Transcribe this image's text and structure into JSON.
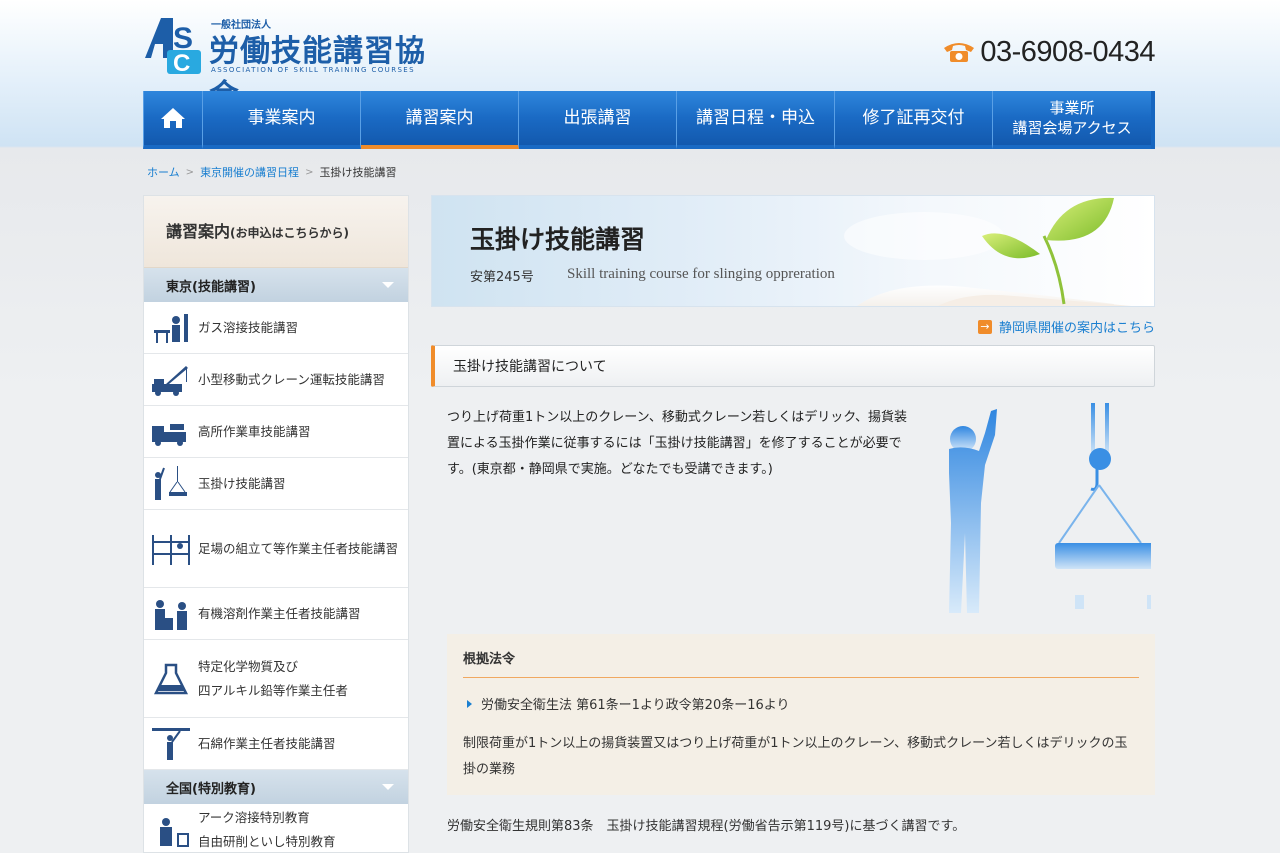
{
  "header": {
    "org_small": "一般社団法人",
    "org_name": "労働技能講習協会",
    "org_en": "ASSOCIATION OF SKILL TRAINING COURSES",
    "phone": "03-6908-0434"
  },
  "nav": {
    "items": [
      {
        "label": "事業案内"
      },
      {
        "label": "講習案内"
      },
      {
        "label": "出張講習"
      },
      {
        "label": "講習日程・申込"
      },
      {
        "label": "修了証再交付"
      }
    ],
    "last_line1": "事業所",
    "last_line2": "講習会場アクセス"
  },
  "breadcrumb": {
    "home": "ホーム",
    "parent": "東京開催の講習日程",
    "current": "玉掛け技能講習",
    "sep": ">"
  },
  "sidebar": {
    "title": "講習案内",
    "title_sub": "(お申込はこちらから)",
    "categories": [
      "東京(技能講習)",
      "全国(特別教育)"
    ],
    "items": [
      {
        "label": "ガス溶接技能講習"
      },
      {
        "label": "小型移動式クレーン運転技能講習"
      },
      {
        "label": "高所作業車技能講習"
      },
      {
        "label": "玉掛け技能講習"
      },
      {
        "label": "足場の組立て等作業主任者技能講習"
      },
      {
        "label": "有機溶剤作業主任者技能講習"
      },
      {
        "label_line1": "特定化学物質及び",
        "label_line2": "四アルキル鉛等作業主任者"
      },
      {
        "label": "石綿作業主任者技能講習"
      }
    ],
    "items2": [
      {
        "label_line1": "アーク溶接特別教育",
        "label_line2": "自由研削といし特別教育"
      }
    ]
  },
  "main": {
    "banner_title": "玉掛け技能講習",
    "banner_no": "安第245号",
    "banner_en": "Skill training course for slinging oppreration",
    "shizuoka_link": "静岡県開催の案内はこちら",
    "section_title": "玉掛け技能講習について",
    "intro": "つり上げ荷重1トン以上のクレーン、移動式クレーン若しくはデリック、揚貨装置による玉掛作業に従事するには「玉掛け技能講習」を修了することが必要です。(東京都・静岡県で実施。どなたでも受講できます。)",
    "law_title": "根拠法令",
    "law_bullet": "労働安全衛生法 第61条ー1より政令第20条ー16より",
    "law_text": "制限荷重が1トン以上の揚貨装置又はつり上げ荷重が1トン以上のクレーン、移動式クレーン若しくはデリックの玉掛の業務",
    "footnote": "労働安全衛生規則第83条　玉掛け技能講習規程(労働省告示第119号)に基づく講習です。"
  },
  "colors": {
    "brand_blue": "#1d5ea8",
    "nav_blue": "#1a6ac4",
    "accent_orange": "#f08c2a",
    "link_blue": "#1a7fd0"
  },
  "icons": [
    "home-icon",
    "phone-icon",
    "arrow-right-icon",
    "chevron-down-icon"
  ]
}
